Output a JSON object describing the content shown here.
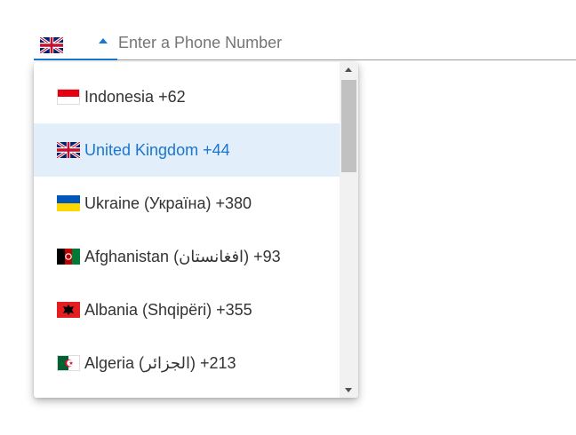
{
  "phone_field": {
    "selected_country_flag": "united-kingdom-flag",
    "placeholder": "Enter a Phone Number",
    "value": "",
    "accent_color": "#1976d2"
  },
  "country_dropdown": {
    "options": [
      {
        "label": "Indonesia +62",
        "flag": "indonesia-flag",
        "selected": false
      },
      {
        "label": "United Kingdom +44",
        "flag": "united-kingdom-flag",
        "selected": true
      },
      {
        "label": "Ukraine (Україна) +380",
        "flag": "ukraine-flag",
        "selected": false
      },
      {
        "label": "Afghanistan (‫افغانستان‬‎) +93",
        "flag": "afghanistan-flag",
        "selected": false
      },
      {
        "label": "Albania (Shqipëri) +355",
        "flag": "albania-flag",
        "selected": false
      },
      {
        "label": "Algeria (‫الجزائر‬‎) +213",
        "flag": "algeria-flag",
        "selected": false
      }
    ],
    "highlight_color": "#e3eefb"
  }
}
